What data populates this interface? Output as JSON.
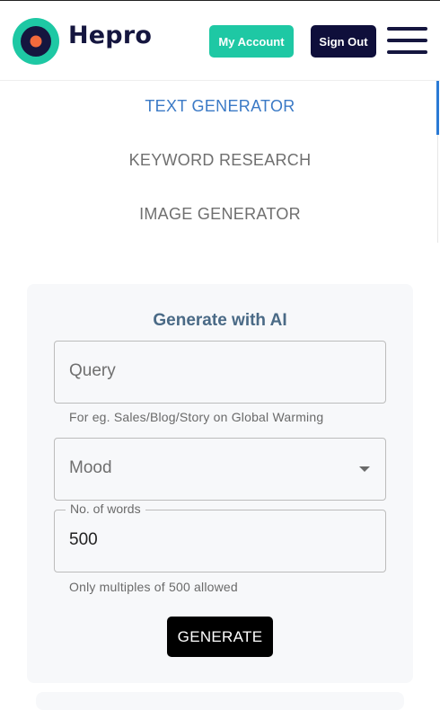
{
  "header": {
    "brand": "Hepro",
    "my_account_label": "My Account",
    "sign_out_label": "Sign Out",
    "menu_icon": "hamburger-menu-icon",
    "logo_colors": {
      "ring": "#1ec8a4",
      "inner": "#15163f",
      "dot": "#f26a3c"
    }
  },
  "nav": {
    "items": [
      {
        "label": "TEXT GENERATOR",
        "active": true
      },
      {
        "label": "KEYWORD RESEARCH",
        "active": false
      },
      {
        "label": "IMAGE GENERATOR",
        "active": false
      }
    ]
  },
  "form": {
    "title": "Generate with AI",
    "query": {
      "placeholder": "Query",
      "helper": "For eg. Sales/Blog/Story on Global Warming"
    },
    "mood": {
      "placeholder": "Mood"
    },
    "words": {
      "label": "No. of words",
      "value": "500",
      "helper": "Only multiples of 500 allowed"
    },
    "generate_label": "GENERATE"
  },
  "colors": {
    "accent_green": "#1ec8a4",
    "navy": "#0f0f3b",
    "active_link": "#3b7ac6",
    "card_bg": "#f7f8fa"
  }
}
